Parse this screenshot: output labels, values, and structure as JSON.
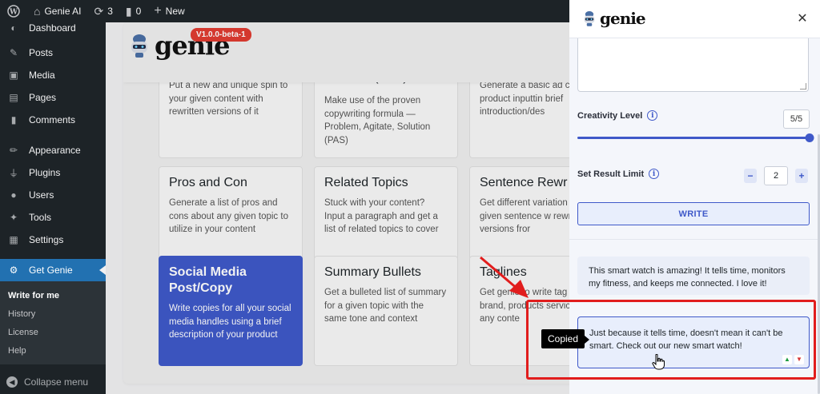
{
  "adminbar": {
    "site_name": "Genie AI",
    "updates_count": "3",
    "comments_count": "0",
    "new_label": "New"
  },
  "sidebar": {
    "partial_item": "Dashboard",
    "items": [
      {
        "label": "Posts",
        "icon": "pin-icon"
      },
      {
        "label": "Media",
        "icon": "media-icon"
      },
      {
        "label": "Pages",
        "icon": "pages-icon"
      },
      {
        "label": "Comments",
        "icon": "comments-icon"
      }
    ],
    "items2": [
      {
        "label": "Appearance",
        "icon": "brush-icon"
      },
      {
        "label": "Plugins",
        "icon": "plug-icon"
      },
      {
        "label": "Users",
        "icon": "user-icon"
      },
      {
        "label": "Tools",
        "icon": "wrench-icon"
      },
      {
        "label": "Settings",
        "icon": "settings-icon"
      }
    ],
    "active": {
      "label": "Get Genie",
      "icon": "gear-icon"
    },
    "submenu": [
      "Write for me",
      "History",
      "License",
      "Help"
    ],
    "collapse_label": "Collapse menu"
  },
  "genie": {
    "logo_text": "genie",
    "version": "V1.0.0-beta-1"
  },
  "cards": {
    "row0": [
      {
        "title": "",
        "desc": "Put a new and unique spin to your given content with rewritten versions of it"
      },
      {
        "title": "Solution (PAS)",
        "desc": "Make use of the proven copywriting formula — Problem, Agitate, Solution (PAS)"
      },
      {
        "title": "",
        "desc": "Generate a basic ad co your product inputtin brief introduction/des"
      }
    ],
    "row1": [
      {
        "title": "Pros and Con",
        "desc": "Generate a list of pros and cons about any given topic to utilize in your content"
      },
      {
        "title": "Related Topics",
        "desc": "Stuck with your content? Input a paragraph and get a list of related topics to cover"
      },
      {
        "title": "Sentence Rewr",
        "desc": "Get different variation your given sentence w rewritten versions fror"
      }
    ],
    "row2": [
      {
        "title": "Social Media Post/Copy",
        "desc": "Write copies for all your social media handles using a brief description of your product"
      },
      {
        "title": "Summary Bullets",
        "desc": "Get a bulleted list of summary for a given topic with the same tone and context"
      },
      {
        "title": "Taglines",
        "desc": "Get genie to write tag your brand, products services, or any conte"
      }
    ]
  },
  "panel": {
    "logo_text": "genie",
    "creativity_label": "Creativity Level",
    "creativity_value": "5/5",
    "creativity_fraction": 1.0,
    "result_limit_label": "Set Result Limit",
    "result_limit_value": "2",
    "minus": "−",
    "plus": "+",
    "write_label": "WRITE",
    "results": [
      "This smart watch is amazing! It tells time, monitors my fitness, and keeps me connected. I love it!",
      "Just because it tells time, doesn't mean it can't be smart. Check out our new smart watch!"
    ]
  },
  "tooltip": {
    "text": "Copied"
  },
  "colors": {
    "accent": "#3f59c9",
    "admin_dark": "#1d2327",
    "wp_blue": "#2271b1",
    "annotation_red": "#e11d1d"
  }
}
